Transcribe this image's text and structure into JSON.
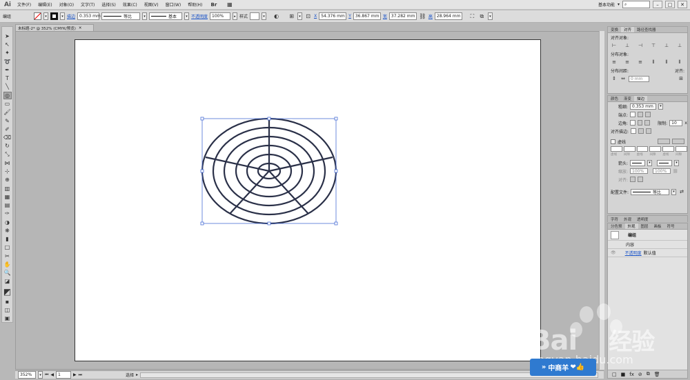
{
  "app": {
    "logo": "Ai",
    "workspace": "基本功能",
    "search_icon": "search-icon"
  },
  "menu": [
    "文件(F)",
    "编辑(E)",
    "对象(O)",
    "文字(T)",
    "选择(S)",
    "效果(C)",
    "视图(V)",
    "窗口(W)",
    "帮助(H)"
  ],
  "control": {
    "selection": "编组",
    "stroke_label": "描边",
    "stroke_value": "0.353 mm",
    "profile": "等比",
    "brush": "基本",
    "opacity_label": "不透明度",
    "opacity_value": "100%",
    "style_label": "样式",
    "x_label": "X",
    "x_value": "54.376 mm",
    "y_label": "Y",
    "y_value": "36.867 mm",
    "w_label": "宽",
    "w_value": "37.282 mm",
    "h_label": "高",
    "h_value": "28.964 mm"
  },
  "document": {
    "tab": "未标题-2* @ 352% (CMYK/预览)"
  },
  "status": {
    "zoom": "352%",
    "page": "1",
    "tool": "选择"
  },
  "align_panel": {
    "tabs": [
      "变换",
      "对齐",
      "路径查找器"
    ],
    "align_objects": "对齐对象:",
    "distribute_objects": "分布对象:",
    "distribute_spacing": "分布间距:",
    "align_to": "对齐:",
    "spacing_value": "0 mm"
  },
  "stroke_panel": {
    "tabs": [
      "颜色",
      "渐变",
      "描边"
    ],
    "weight_label": "粗细:",
    "weight_value": "0.353 mm",
    "cap_label": "端点:",
    "corner_label": "边角:",
    "limit_label": "限制:",
    "limit_value": "10",
    "align_label": "对齐描边:",
    "dashed_label": "虚线",
    "dash_labels": [
      "虚线",
      "间隙",
      "虚线",
      "间隙",
      "虚线",
      "间隙"
    ],
    "arrow_label": "箭头:",
    "scale_label": "缩放:",
    "scale_values": [
      "100%",
      "100%"
    ],
    "align_arrow_label": "对齐:",
    "profile_label": "配置文件:",
    "profile_value": "等比"
  },
  "appearance_panel": {
    "tabs_top": [
      "字符",
      "外观",
      "透明度"
    ],
    "tabs_bottom": [
      "分色预",
      "外观",
      "图层",
      "画板",
      "符号"
    ],
    "group": "编组",
    "contents": "内容",
    "opacity_link": "不透明度",
    "opacity_value": "默认值"
  },
  "watermark": {
    "brand": "Bai",
    "brand2": "经验",
    "url": "jingyan.baidu.com",
    "badge": "中商羊"
  },
  "colors": {
    "artwork_stroke": "#2a3048",
    "selection": "#4a6fd6",
    "accent_link": "#1c55c8"
  }
}
